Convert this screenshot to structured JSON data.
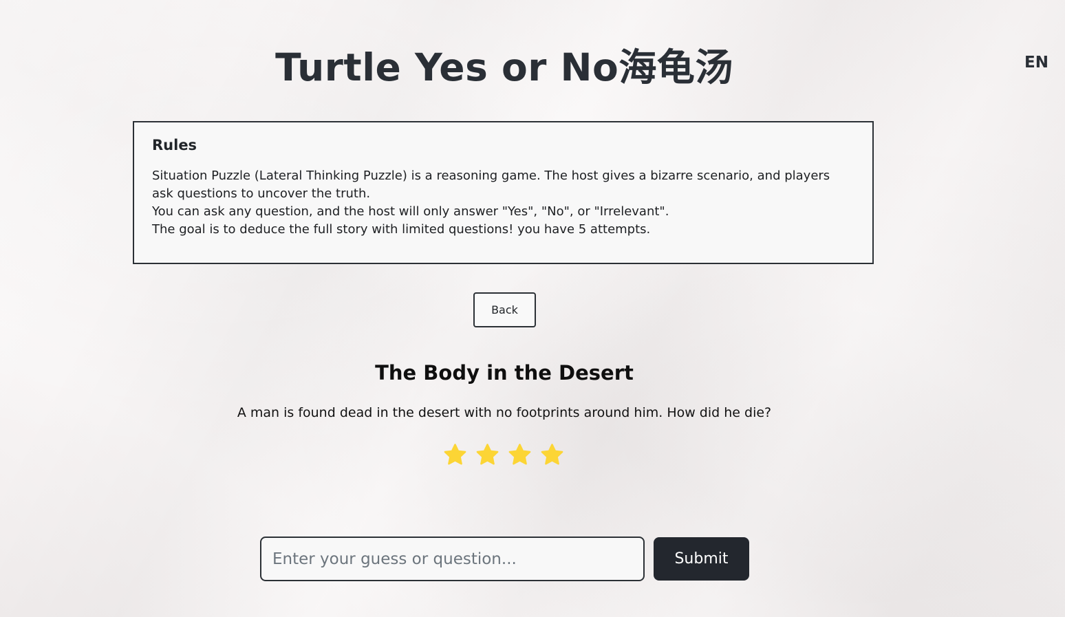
{
  "header": {
    "title": "Turtle Yes or No海龟汤",
    "language_toggle": "EN"
  },
  "rules": {
    "title": "Rules",
    "lines": [
      "Situation Puzzle (Lateral Thinking Puzzle) is a reasoning game. The host gives a bizarre scenario, and players ask questions to uncover the truth.",
      "You can ask any question, and the host will only answer \"Yes\", \"No\", or \"Irrelevant\".",
      "The goal is to deduce the full story with limited questions! you have 5 attempts."
    ]
  },
  "navigation": {
    "back_label": "Back"
  },
  "puzzle": {
    "title": "The Body in the Desert",
    "description": "A man is found dead in the desert with no footprints around him. How did he die?",
    "difficulty_stars": 4,
    "star_color": "#fcd535",
    "star_icon": "star-icon"
  },
  "guess_form": {
    "input_value": "",
    "input_placeholder": "Enter your guess or question...",
    "submit_label": "Submit",
    "submit_color": "#23272e"
  }
}
